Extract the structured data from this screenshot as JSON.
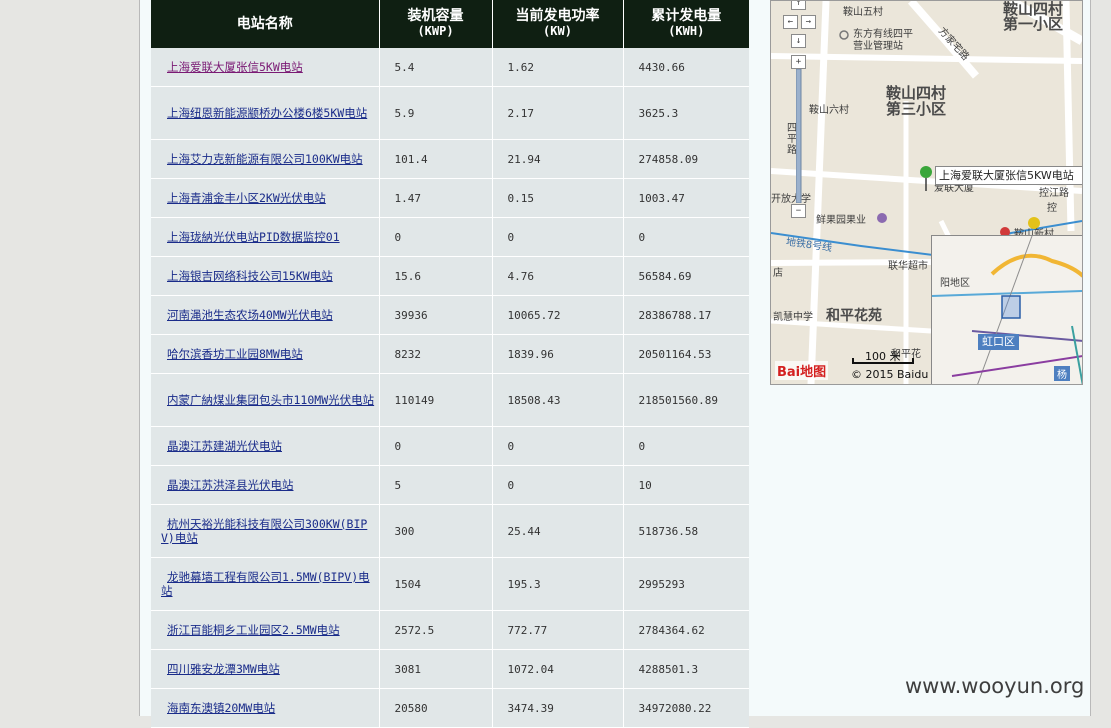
{
  "table": {
    "headers": [
      {
        "title": "电站名称",
        "unit": ""
      },
      {
        "title": "装机容量",
        "unit": "(KWP)"
      },
      {
        "title": "当前发电功率",
        "unit": "(KW)"
      },
      {
        "title": "累计发电量",
        "unit": "(KWH)"
      }
    ],
    "rows": [
      {
        "name": "上海爱联大厦张信5KW电站",
        "capacity": "5.4",
        "power": "1.62",
        "energy": "4430.66"
      },
      {
        "name": "上海纽恩新能源颛桥办公楼6楼5KW电站",
        "capacity": "5.9",
        "power": "2.17",
        "energy": "3625.3"
      },
      {
        "name": "上海艾力克新能源有限公司100KW电站",
        "capacity": "101.4",
        "power": "21.94",
        "energy": "274858.09"
      },
      {
        "name": "上海青浦金丰小区2KW光伏电站",
        "capacity": "1.47",
        "power": "0.15",
        "energy": "1003.47"
      },
      {
        "name": "上海珑納光伏电站PID数据监控01",
        "capacity": "0",
        "power": "0",
        "energy": "0"
      },
      {
        "name": "上海银吉网络科技公司15KW电站",
        "capacity": "15.6",
        "power": "4.76",
        "energy": "56584.69"
      },
      {
        "name": "河南渑池生态农场40MW光伏电站",
        "capacity": "39936",
        "power": "10065.72",
        "energy": "28386788.17"
      },
      {
        "name": "哈尔滨香坊工业园8MW电站",
        "capacity": "8232",
        "power": "1839.96",
        "energy": "20501164.53"
      },
      {
        "name": "内蒙广納煤业集团包头市110MW光伏电站",
        "capacity": "110149",
        "power": "18508.43",
        "energy": "218501560.89"
      },
      {
        "name": "晶澳江苏建湖光伏电站",
        "capacity": "0",
        "power": "0",
        "energy": "0"
      },
      {
        "name": "晶澳江苏洪泽县光伏电站",
        "capacity": "5",
        "power": "0",
        "energy": "10"
      },
      {
        "name": "杭州天裕光能科技有限公司300KW(BIPV)电站",
        "capacity": "300",
        "power": "25.44",
        "energy": "518736.58"
      },
      {
        "name": "龙驰幕墙工程有限公司1.5MW(BIPV)电站",
        "capacity": "1504",
        "power": "195.3",
        "energy": "2995293"
      },
      {
        "name": "浙江百能桐乡工业园区2.5MW电站",
        "capacity": "2572.5",
        "power": "772.77",
        "energy": "2784364.62"
      },
      {
        "name": "四川雅安龙潭3MW电站",
        "capacity": "3081",
        "power": "1072.04",
        "energy": "4288501.3"
      },
      {
        "name": "海南东澳镇20MW电站",
        "capacity": "20580",
        "power": "3474.39",
        "energy": "34972080.22"
      }
    ]
  },
  "map": {
    "labels": {
      "anshan_wucun": "鞍山五村",
      "anshan_sicun_1": "鞍山四村",
      "anshan_sicun_1b": "第一小区",
      "dongfang": "东方有线四平",
      "dongfang_b": "营业管理站",
      "fangjia_rd": "方家宅路",
      "anshan_sicun_3": "鞍山四村",
      "anshan_sicun_3b": "第三小区",
      "anshan_liucun": "鞍山六村",
      "siping_rd": "四平路",
      "kaifang_univ": "开放大学",
      "xianguo": "鲜果园果业",
      "metro8": "地铁8号线",
      "anshan_xincun": "鞍山新村",
      "kongjiang": "控江路",
      "lianhua": "联华超市",
      "heping": "和平花苑",
      "kaihui": "凯慧中学",
      "dian": "店",
      "yangpu_d": "阳地区",
      "hongkou": "虹口区",
      "yang": "杨",
      "station_tip": "上海爱联大厦张信5KW电站",
      "anlian_small": "爱联大厦",
      "ke": "控",
      "heping_small": "和平花"
    },
    "scale": "100 米",
    "copyright": "© 2015 Baidu",
    "logo": "Bai地图",
    "nav": {
      "up": "↑",
      "left": "←",
      "right": "→",
      "down": "↓",
      "zoom_in": "+",
      "zoom_out": "−"
    },
    "colors": {
      "metro_line": "#3b8ed0",
      "road": "#ffffff",
      "block": "#ebe6da"
    }
  },
  "watermark": "www.wooyun.org"
}
